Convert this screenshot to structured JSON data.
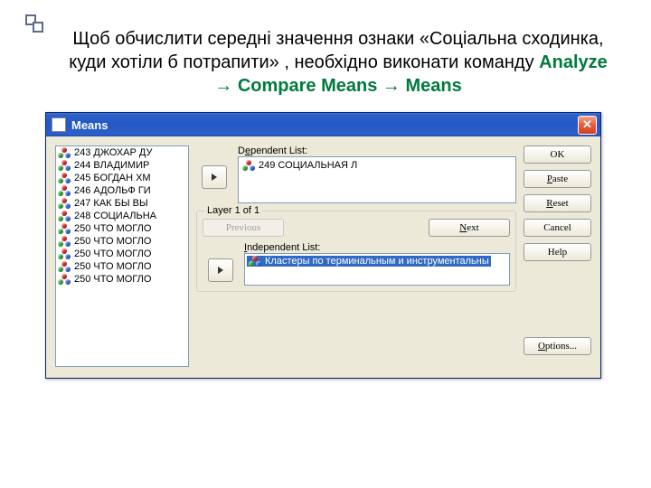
{
  "instruction": {
    "text_pre": "Щоб обчислити середні значення ознаки «Соціальна сходинка, куди хотіли б потрапити» , необхідно виконати команду ",
    "cmd": "Analyze → Compare Means → Means"
  },
  "dialog": {
    "title": "Means",
    "close": "✕",
    "source_items": [
      "243  ДЖОХАР ДУ",
      "244  ВЛАДИМИР",
      "245  БОГДАН ХМ",
      "246  АДОЛЬФ ГИ",
      "247  КАК БЫ ВЫ",
      "248  СОЦИАЛЬНА",
      "250  ЧТО МОГЛО",
      "250  ЧТО МОГЛО",
      "250  ЧТО МОГЛО",
      "250  ЧТО МОГЛО",
      "250  ЧТО МОГЛО"
    ],
    "dependent": {
      "label": "Dependent List:",
      "items": [
        "249  СОЦИАЛЬНАЯ Л"
      ]
    },
    "layer": {
      "title": "Layer 1 of 1",
      "prev": "Previous",
      "next": "Next"
    },
    "independent": {
      "label": "Independent List:",
      "selected": "Кластеры по терминальным и инструментальны"
    },
    "buttons": {
      "ok": "OK",
      "paste": "Paste",
      "reset": "Reset",
      "cancel": "Cancel",
      "help": "Help",
      "options": "Options..."
    }
  }
}
